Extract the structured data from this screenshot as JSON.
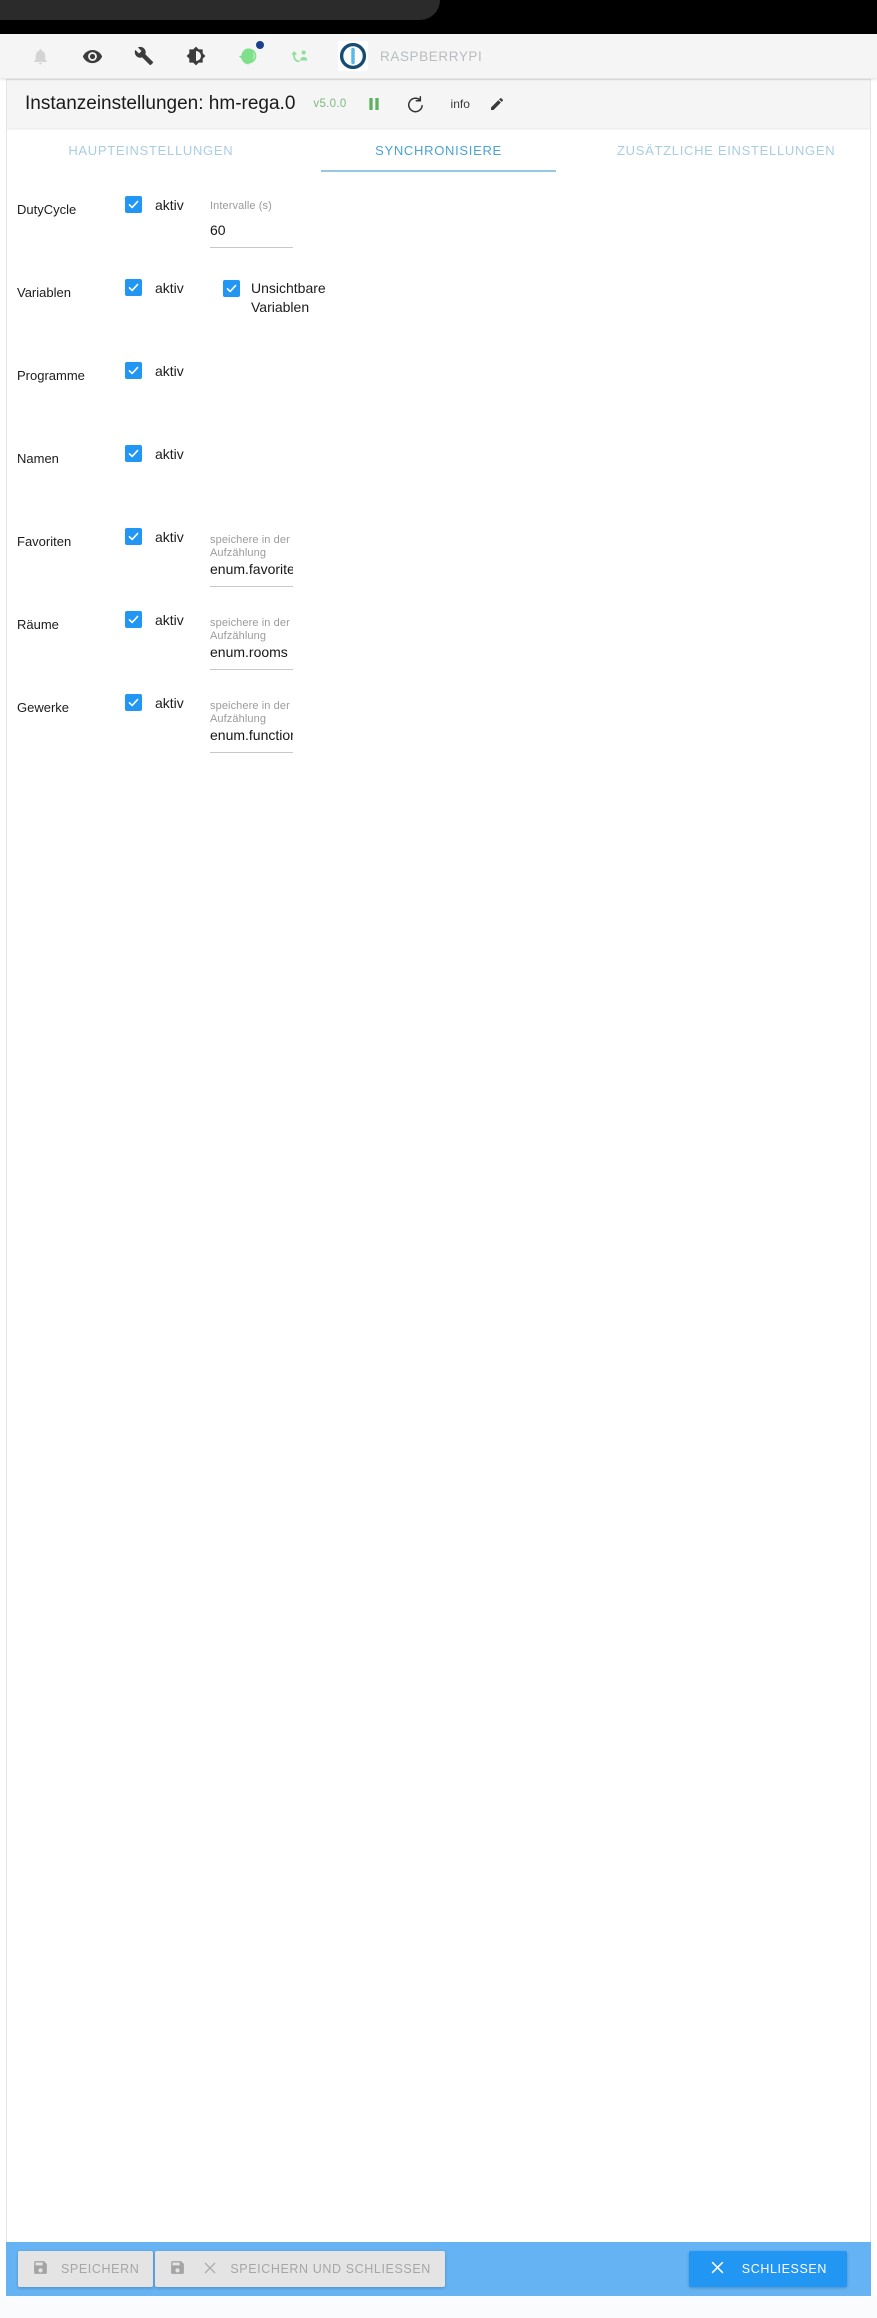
{
  "browser": {
    "tab_strip": ""
  },
  "toolbar": {
    "icons": [
      {
        "name": "bell-icon",
        "label": "notifications"
      },
      {
        "name": "eye-icon",
        "label": "expert-mode"
      },
      {
        "name": "wrench-icon",
        "label": "settings"
      },
      {
        "name": "brightness-icon",
        "label": "theme-toggle"
      },
      {
        "name": "head-icon",
        "label": "user-profile"
      },
      {
        "name": "sync-icon",
        "label": "synchronize"
      }
    ],
    "logo_name": "iobroker-logo",
    "host_name": "RASPBERRYPI"
  },
  "header": {
    "title": "Instanzeinstellungen: hm-rega.0",
    "version": "v5.0.0",
    "pause_icon": "pause-icon",
    "refresh_icon": "refresh-icon",
    "info_label": "info",
    "edit_icon": "pencil-icon"
  },
  "tabs": [
    {
      "label": "HAUPTEINSTELLUNGEN",
      "active": false
    },
    {
      "label": "SYNCHRONISIERE",
      "active": true
    },
    {
      "label": "ZUSÄTZLICHE EINSTELLUNGEN",
      "active": false
    }
  ],
  "active_tab_index": 1,
  "form": {
    "checkbox_label": "aktiv",
    "rows": [
      {
        "id": "dutycycle",
        "label": "DutyCycle",
        "active": true,
        "field": {
          "label": "Intervalle (s)",
          "value": "60"
        }
      },
      {
        "id": "variablen",
        "label": "Variablen",
        "active": true,
        "secondary": {
          "label": "Unsichtbare Variablen",
          "checked": true
        }
      },
      {
        "id": "programme",
        "label": "Programme",
        "active": true
      },
      {
        "id": "namen",
        "label": "Namen",
        "active": true
      },
      {
        "id": "favoriten",
        "label": "Favoriten",
        "active": true,
        "field": {
          "label": "speichere in der Aufzählung",
          "value": "enum.favorites"
        }
      },
      {
        "id": "raeume",
        "label": "Räume",
        "active": true,
        "field": {
          "label": "speichere in der Aufzählung",
          "value": "enum.rooms"
        }
      },
      {
        "id": "gewerke",
        "label": "Gewerke",
        "active": true,
        "field": {
          "label": "speichere in der Aufzählung",
          "value": "enum.functions"
        }
      }
    ]
  },
  "actions": {
    "save": {
      "label": "SPEICHERN",
      "icon": "save-icon",
      "disabled": true
    },
    "save_close": {
      "label": "SPEICHERN UND SCHLIESSEN",
      "icon": "save-icon",
      "close_icon": "close-icon",
      "disabled": true
    },
    "close": {
      "label": "SCHLIESSEN",
      "icon": "close-icon",
      "disabled": false
    }
  },
  "colors": {
    "accent": "#2196f3",
    "action_bar": "#66b3f3",
    "tab_active": "#4ba3d3",
    "tab_inactive": "#a9cde2",
    "version": "#7cb97c",
    "toolbar_bg": "#f5f5f5"
  }
}
